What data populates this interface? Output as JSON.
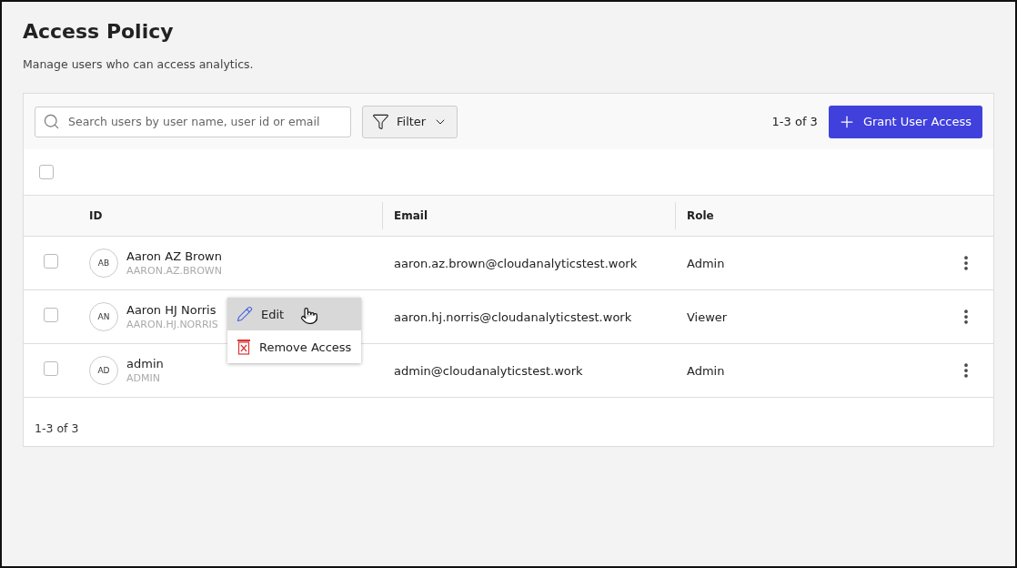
{
  "page": {
    "title": "Access Policy",
    "subtitle": "Manage users who can access analytics."
  },
  "toolbar": {
    "search": {
      "placeholder": "Search users by user name, user id or email"
    },
    "filter": "Filter",
    "count": "1-3 of 3",
    "grant_button": "Grant User Access"
  },
  "select_all": {
    "checked": false
  },
  "table": {
    "columns": [
      "ID",
      "Email",
      "Role"
    ],
    "rows": [
      {
        "initials": "AB",
        "name": "Aaron AZ Brown",
        "user_id": "AARON.AZ.BROWN",
        "email": "aaron.az.brown@cloudanalyticstest.work",
        "role": "Admin",
        "checked": false
      },
      {
        "initials": "AN",
        "name": "Aaron HJ Norris",
        "user_id": "AARON.HJ.NORRIS",
        "email": "aaron.hj.norris@cloudanalyticstest.work",
        "role": "Viewer",
        "checked": false
      },
      {
        "initials": "AD",
        "name": "admin",
        "user_id": "ADMIN",
        "email": "admin@cloudanalyticstest.work",
        "role": "Admin",
        "checked": false
      }
    ]
  },
  "context_menu": {
    "items": [
      {
        "kind": "edit",
        "label": "Edit",
        "selected": true
      },
      {
        "kind": "remove",
        "label": "Remove Access",
        "selected": false
      }
    ]
  },
  "footer": {
    "count": "1-3 of 3"
  }
}
